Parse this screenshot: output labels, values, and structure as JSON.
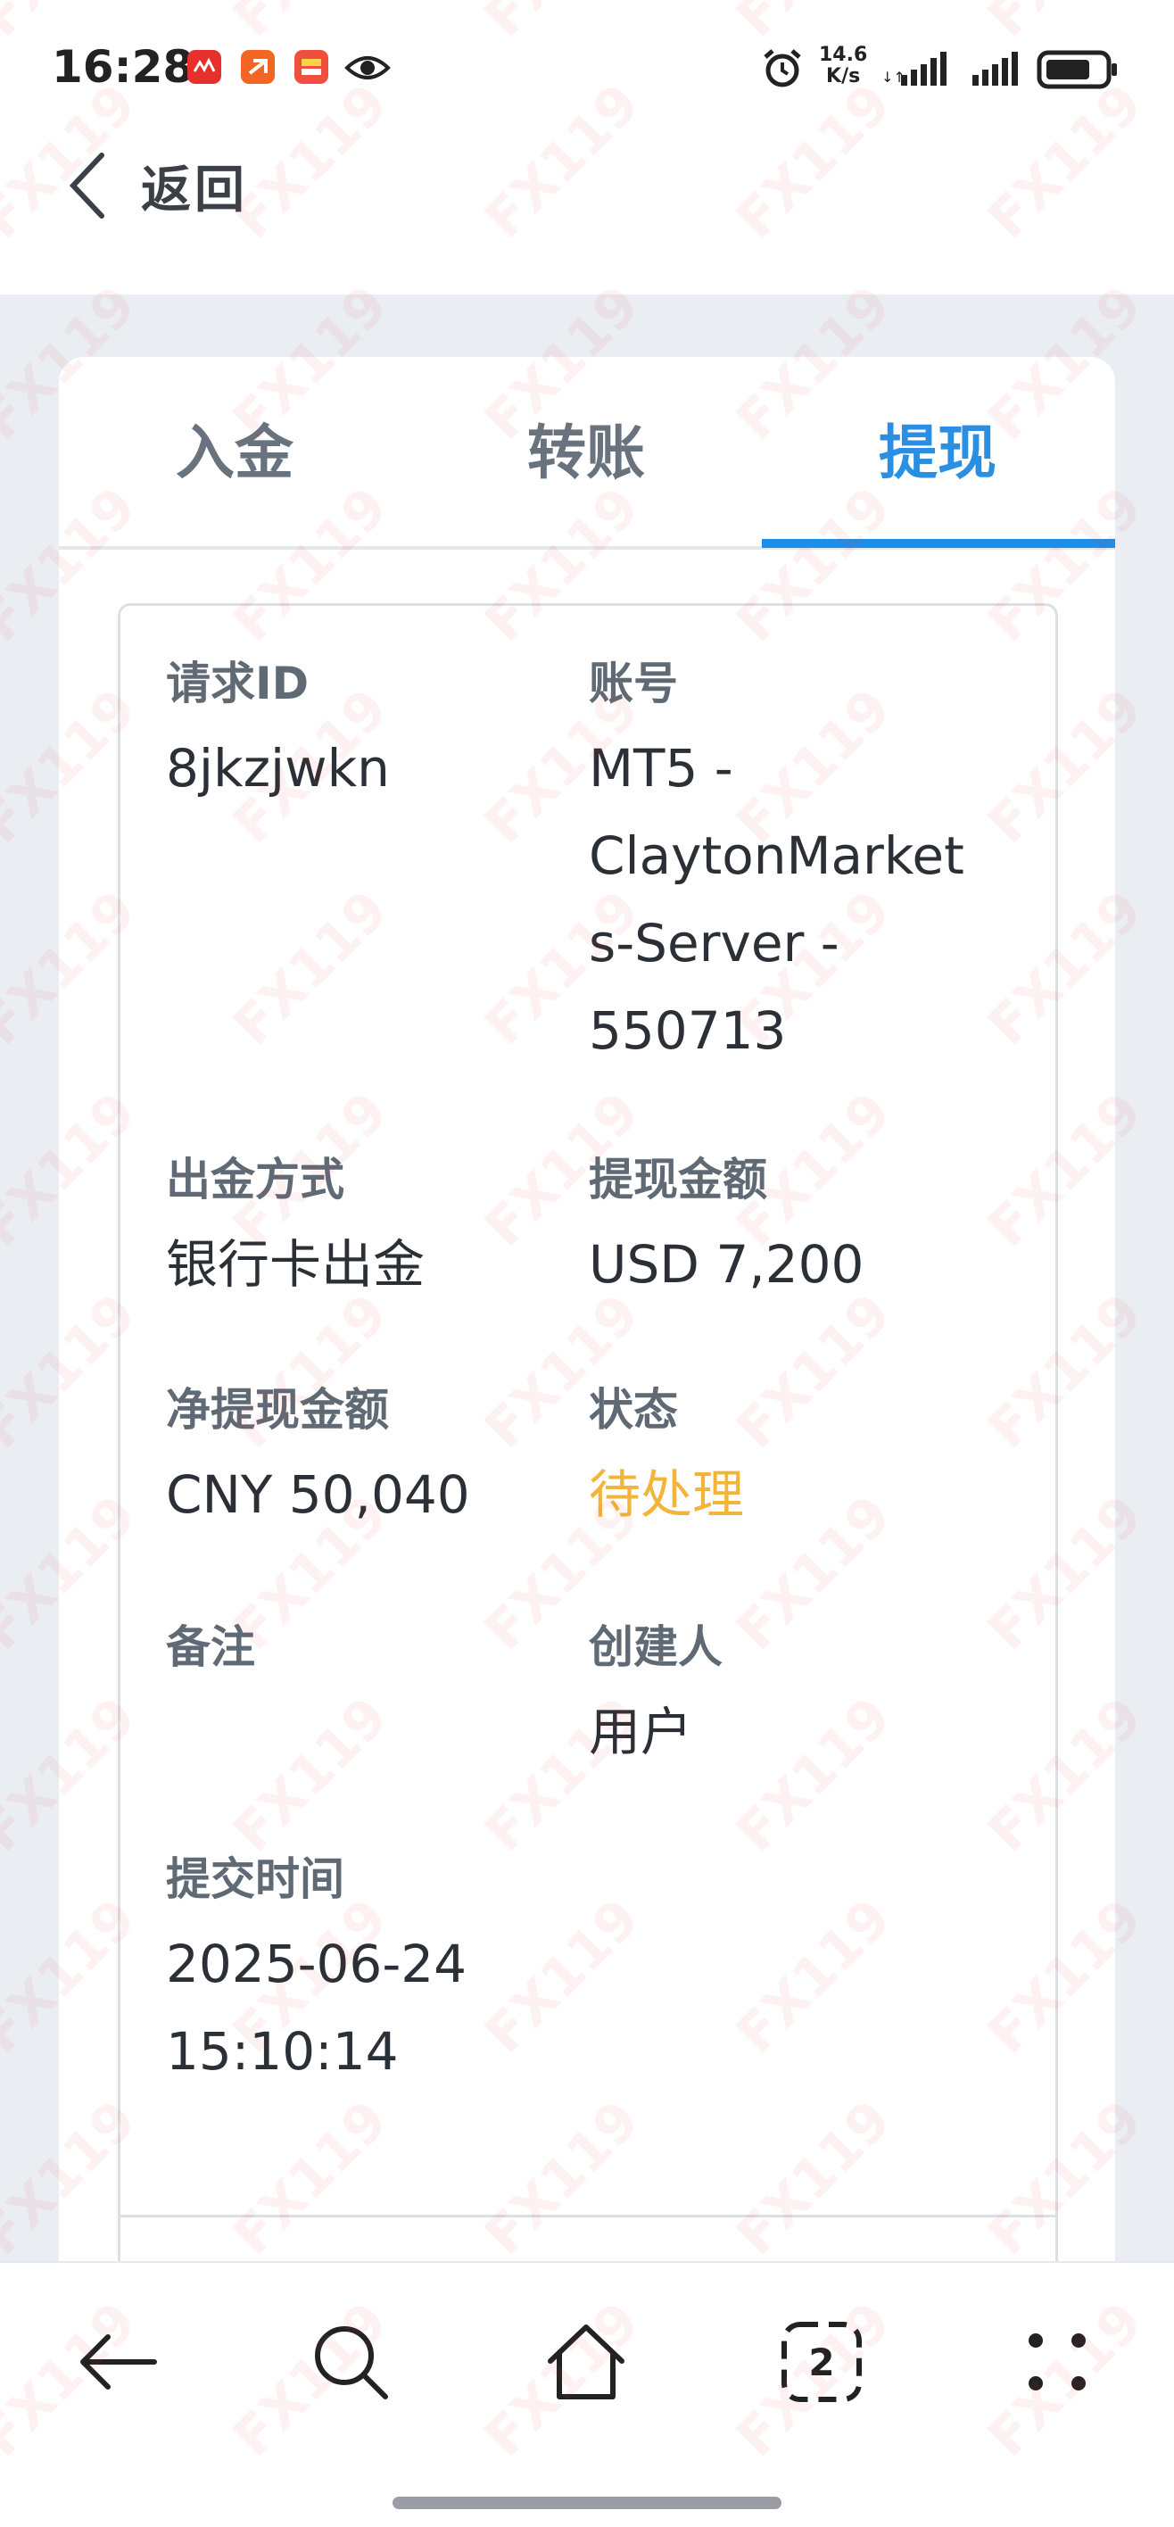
{
  "status_bar": {
    "time": "16:28",
    "net_speed_value": "14.6",
    "net_speed_unit": "K/s",
    "colors": {
      "notif_1": "#e5302e",
      "notif_2": "#f26522",
      "notif_3": "#f04e3e"
    }
  },
  "header": {
    "back_label": "返回"
  },
  "tabs": [
    {
      "label": "入金",
      "active": false
    },
    {
      "label": "转账",
      "active": false
    },
    {
      "label": "提现",
      "active": true
    }
  ],
  "detail": {
    "request_id": {
      "label": "请求ID",
      "value": "8jkzjwkn"
    },
    "account": {
      "label": "账号",
      "value_lines": [
        "MT5 -",
        "ClaytonMarket",
        "s-Server -",
        "550713"
      ]
    },
    "method": {
      "label": "出金方式",
      "value": "银行卡出金"
    },
    "amount": {
      "label": "提现金额",
      "value": "USD 7,200"
    },
    "net_amount": {
      "label": "净提现金额",
      "value": "CNY 50,040"
    },
    "status": {
      "label": "状态",
      "value": "待处理"
    },
    "note": {
      "label": "备注",
      "value": ""
    },
    "creator": {
      "label": "创建人",
      "value": "用户"
    },
    "submit_time": {
      "label": "提交时间",
      "value_lines": [
        "2025-06-24",
        "15:10:14"
      ]
    }
  },
  "bottom_nav": {
    "tabs_count": "2"
  },
  "watermark": "FX119",
  "colors": {
    "accent": "#1e8fe8",
    "pending": "#f2b53a",
    "label": "#5f6a75",
    "text": "#2b2f36"
  }
}
